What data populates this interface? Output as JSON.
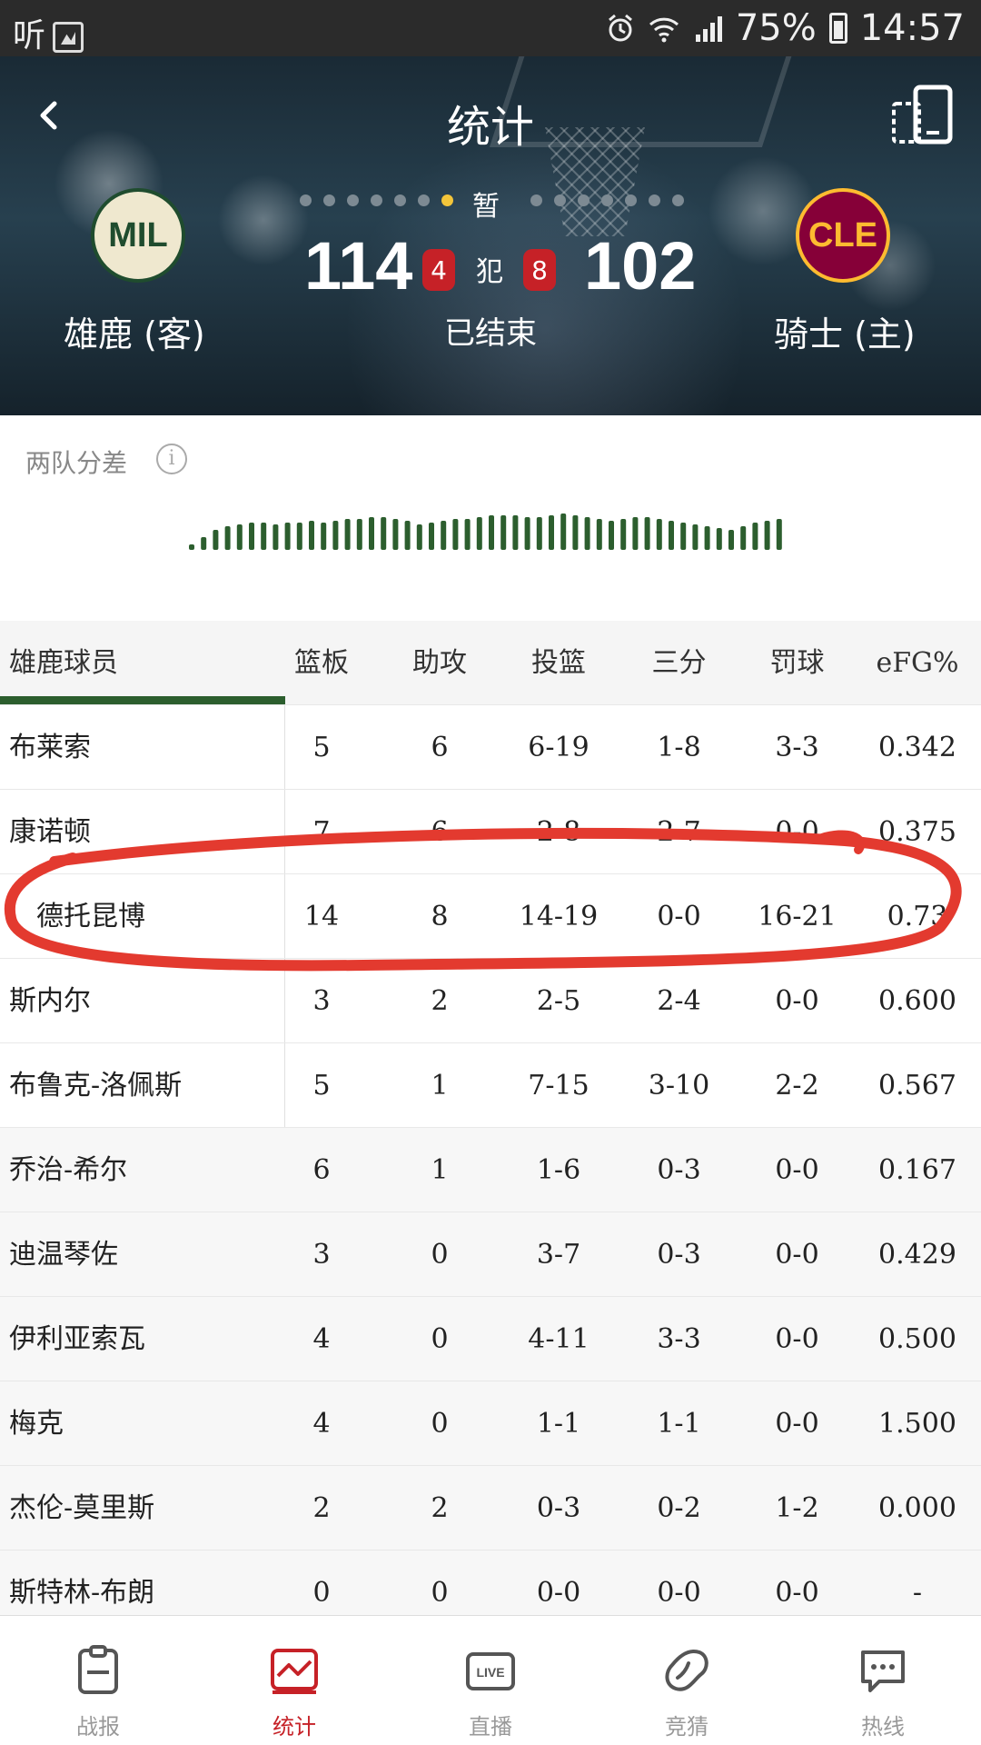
{
  "status_bar": {
    "app_glyph": "听",
    "battery": "75%",
    "time": "14:57",
    "network": "4G"
  },
  "header": {
    "title": "统计",
    "away": {
      "abbr": "MIL",
      "name": "雄鹿 (客)",
      "score": "114",
      "fouls": "4",
      "color": "#1f4c2e"
    },
    "home": {
      "abbr": "CLE",
      "name": "骑士 (主)",
      "score": "102",
      "fouls": "8",
      "color": "#860038"
    },
    "pause_label": "暂",
    "foul_label": "犯",
    "status": "已结束"
  },
  "differential": {
    "title": "两队分差",
    "info_icon": "i",
    "bar_color": "#2c5e2e"
  },
  "table": {
    "columns": [
      "雄鹿球员",
      "篮板",
      "助攻",
      "投篮",
      "三分",
      "罚球",
      "eFG%"
    ],
    "rows": [
      [
        "布莱索",
        "5",
        "6",
        "6-19",
        "1-8",
        "3-3",
        "0.342"
      ],
      [
        "康诺顿",
        "7",
        "6",
        "2-8",
        "2-7",
        "0-0",
        "0.375"
      ],
      [
        "德托昆博",
        "14",
        "8",
        "14-19",
        "0-0",
        "16-21",
        "0.73"
      ],
      [
        "斯内尔",
        "3",
        "2",
        "2-5",
        "2-4",
        "0-0",
        "0.600"
      ],
      [
        "布鲁克-洛佩斯",
        "5",
        "1",
        "7-15",
        "3-10",
        "2-2",
        "0.567"
      ],
      [
        "乔治-希尔",
        "6",
        "1",
        "1-6",
        "0-3",
        "0-0",
        "0.167"
      ],
      [
        "迪温琴佐",
        "3",
        "0",
        "3-7",
        "0-3",
        "0-0",
        "0.429"
      ],
      [
        "伊利亚索瓦",
        "4",
        "0",
        "4-11",
        "3-3",
        "0-0",
        "0.500"
      ],
      [
        "梅克",
        "4",
        "0",
        "1-1",
        "1-1",
        "0-0",
        "1.500"
      ],
      [
        "杰伦-莫里斯",
        "2",
        "2",
        "0-3",
        "0-2",
        "1-2",
        "0.000"
      ],
      [
        "斯特林-布朗",
        "0",
        "0",
        "0-0",
        "0-0",
        "0-0",
        "-"
      ]
    ]
  },
  "bottom_nav": {
    "items": [
      {
        "label": "战报",
        "icon": "clipboard-icon"
      },
      {
        "label": "统计",
        "icon": "chart-icon"
      },
      {
        "label": "直播",
        "icon": "live-icon"
      },
      {
        "label": "竞猜",
        "icon": "bean-icon"
      },
      {
        "label": "热线",
        "icon": "chat-icon"
      }
    ],
    "active_color": "#c62127"
  }
}
